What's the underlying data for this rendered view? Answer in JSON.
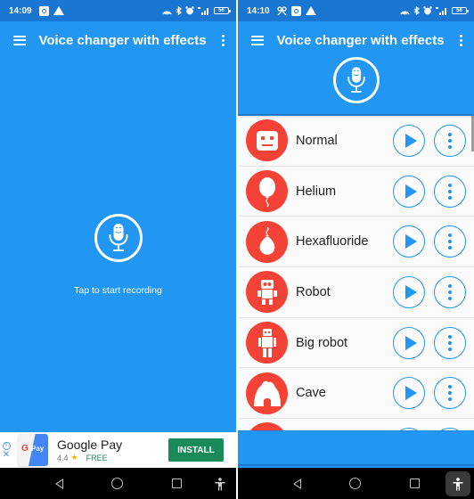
{
  "left_screen": {
    "status_bar": {
      "time": "14:09",
      "battery": "56"
    },
    "app_bar": {
      "title": "Voice changer with effects"
    },
    "record_hint": "Tap to start recording",
    "ad": {
      "app_name": "Google Pay",
      "rating": "4.4",
      "star": "★",
      "price": "FREE",
      "logo_g": "G",
      "logo_pay": "Pay",
      "info_glyph": "i",
      "close_glyph": "✕",
      "install_label": "INSTALL"
    }
  },
  "right_screen": {
    "status_bar": {
      "time": "14:10",
      "battery": "56"
    },
    "app_bar": {
      "title": "Voice changer with effects"
    },
    "effects": [
      {
        "name": "Normal",
        "icon": "robot-face-icon"
      },
      {
        "name": "Helium",
        "icon": "balloon-icon"
      },
      {
        "name": "Hexafluoride",
        "icon": "heavy-balloon-icon"
      },
      {
        "name": "Robot",
        "icon": "robot-icon"
      },
      {
        "name": "Big robot",
        "icon": "big-robot-icon"
      },
      {
        "name": "Cave",
        "icon": "cave-icon"
      }
    ]
  },
  "colors": {
    "primary": "#2196f3",
    "primary_dark": "#1976d2",
    "effect_red": "#f44336",
    "install_green": "#1a8a5a"
  }
}
